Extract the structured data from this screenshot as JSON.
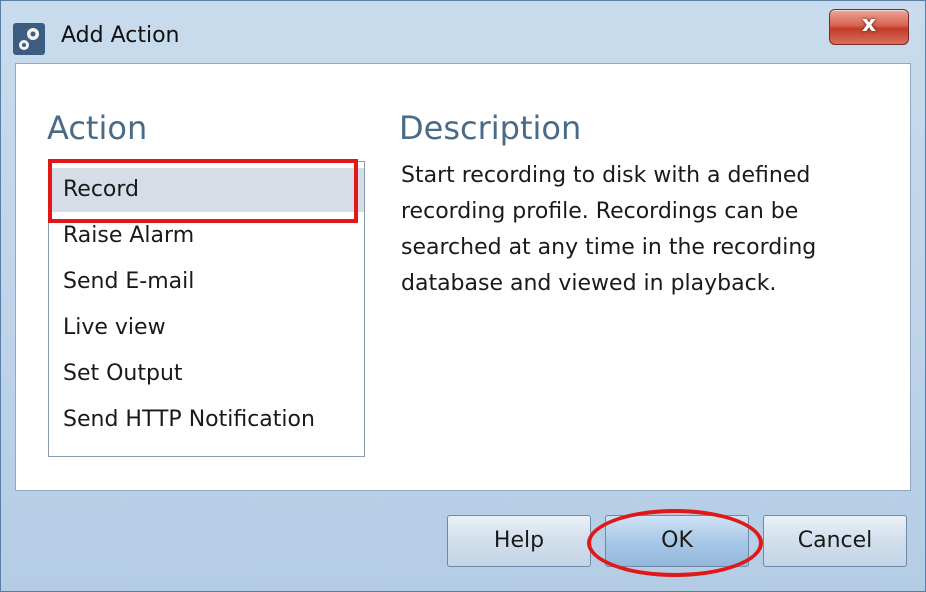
{
  "dialog": {
    "title": "Add Action",
    "close_label": "x"
  },
  "action_column": {
    "heading": "Action",
    "items": [
      {
        "label": "Record",
        "selected": true
      },
      {
        "label": "Raise Alarm",
        "selected": false
      },
      {
        "label": "Send E-mail",
        "selected": false
      },
      {
        "label": "Live view",
        "selected": false
      },
      {
        "label": "Set Output",
        "selected": false
      },
      {
        "label": "Send HTTP Notification",
        "selected": false
      }
    ]
  },
  "description_column": {
    "heading": "Description",
    "text": "Start recording to disk with a defined recording profile. Recordings can be searched at any time in the recording database and viewed in playback."
  },
  "buttons": {
    "help": "Help",
    "ok": "OK",
    "cancel": "Cancel"
  },
  "colors": {
    "annotation": "#e01818",
    "heading": "#4a6a8a",
    "selected_row": "#d6dde6"
  }
}
